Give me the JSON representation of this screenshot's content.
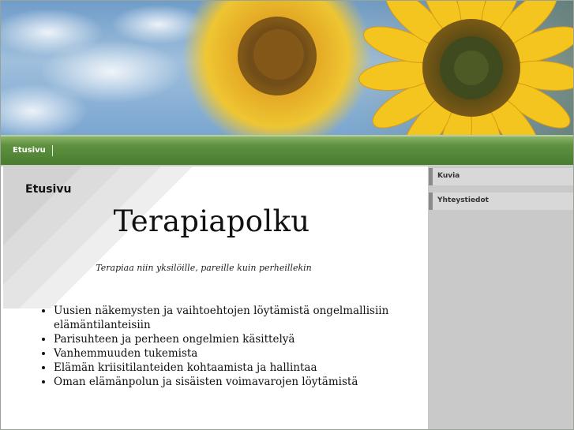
{
  "nav": {
    "items": [
      {
        "label": "Etusivu"
      }
    ]
  },
  "main": {
    "page_heading": "Etusivu",
    "site_title": "Terapiapolku",
    "tagline": "Terapiaa niin yksilöille, pareille kuin perheillekin",
    "services": [
      "Uusien näkemysten ja vaihtoehtojen löytämistä ongelmallisiin elämäntilanteisiin",
      "Parisuhteen ja perheen ongelmien käsittelyä",
      "Vanhemmuuden tukemista",
      "Elämän kriisitilanteiden kohtaamista ja hallintaa",
      "Oman elämänpolun ja sisäisten voimavarojen löytämistä"
    ]
  },
  "sidebar": {
    "links": [
      {
        "label": "Kuvia"
      },
      {
        "label": "Yhteystiedot"
      }
    ]
  },
  "colors": {
    "nav_green": "#4a7c30",
    "sidebar_gray": "#c9c9c9",
    "sky_blue": "#7aa6d1",
    "sunflower_yellow": "#f2c21a"
  }
}
